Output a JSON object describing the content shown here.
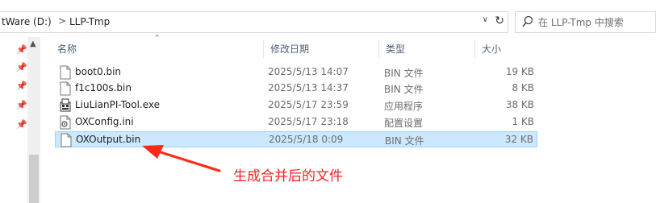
{
  "address_bar": {
    "crumbs": [
      "tWare (D:)",
      "LLP-Tmp"
    ],
    "separator": ">"
  },
  "search": {
    "placeholder": "在 LLP-Tmp 中搜索"
  },
  "columns": {
    "name": "名称",
    "date": "修改日期",
    "type": "类型",
    "size": "大小"
  },
  "files": [
    {
      "name": "boot0.bin",
      "date": "2025/5/13 14:07",
      "type": "BIN 文件",
      "size": "19 KB",
      "icon": "file-icon",
      "selected": false
    },
    {
      "name": "f1c100s.bin",
      "date": "2025/5/13 14:37",
      "type": "BIN 文件",
      "size": "8 KB",
      "icon": "file-icon",
      "selected": false
    },
    {
      "name": "LiuLianPI-Tool.exe",
      "date": "2025/5/17 23:59",
      "type": "应用程序",
      "size": "38 KB",
      "icon": "app-icon",
      "selected": false
    },
    {
      "name": "OXConfig.ini",
      "date": "2025/5/17 23:18",
      "type": "配置设置",
      "size": "1 KB",
      "icon": "settings-file-icon",
      "selected": false
    },
    {
      "name": "OXOutput.bin",
      "date": "2025/5/18 0:09",
      "type": "BIN 文件",
      "size": "32 KB",
      "icon": "file-icon",
      "selected": true
    }
  ],
  "annotation": {
    "text": "生成合并后的文件",
    "color": "#ff2020"
  },
  "colors": {
    "selection_bg": "#cce8ff",
    "selection_border": "#99d1ff",
    "header_text": "#4c607a"
  }
}
